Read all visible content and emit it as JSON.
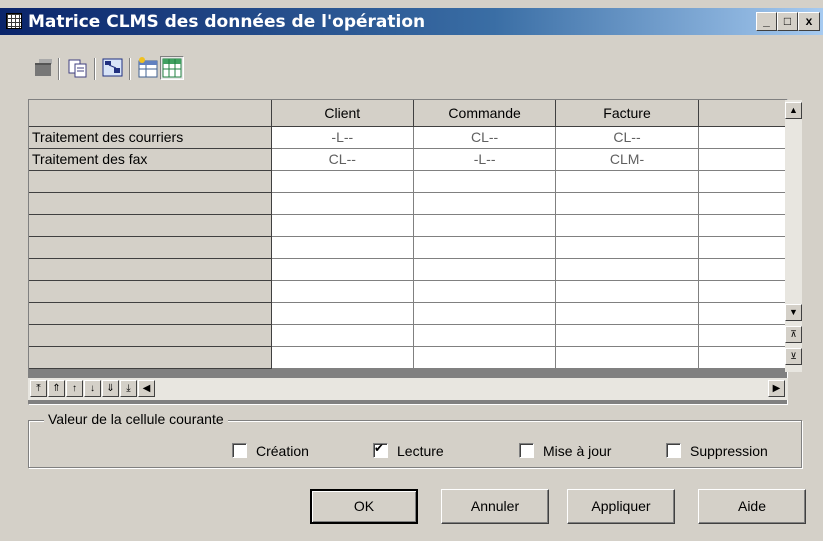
{
  "window": {
    "title": "Matrice CLMS des données de l'opération"
  },
  "title_buttons": {
    "minimize": "_",
    "maximize": "□",
    "close": "x"
  },
  "toolbar": {
    "tools": [
      {
        "icon": "properties-icon"
      },
      {
        "icon": "copy-icon"
      },
      {
        "icon": "find-in-diagram-icon"
      },
      {
        "icon": "add-row-icon"
      },
      {
        "icon": "matrix-view-icon",
        "pressed": true
      }
    ]
  },
  "matrix": {
    "columns": [
      "Client",
      "Commande",
      "Facture",
      ""
    ],
    "rows": [
      {
        "label": "Traitement des courriers",
        "values": [
          "-L--",
          "CL--",
          "CL--",
          ""
        ]
      },
      {
        "label": "Traitement des fax",
        "values": [
          "CL--",
          "-L--",
          "CLM-",
          ""
        ]
      },
      {
        "label": "",
        "values": [
          "",
          "",
          "",
          ""
        ]
      },
      {
        "label": "",
        "values": [
          "",
          "",
          "",
          ""
        ]
      },
      {
        "label": "",
        "values": [
          "",
          "",
          "",
          ""
        ]
      },
      {
        "label": "",
        "values": [
          "",
          "",
          "",
          ""
        ]
      },
      {
        "label": "",
        "values": [
          "",
          "",
          "",
          ""
        ]
      },
      {
        "label": "",
        "values": [
          "",
          "",
          "",
          ""
        ]
      },
      {
        "label": "",
        "values": [
          "",
          "",
          "",
          ""
        ]
      },
      {
        "label": "",
        "values": [
          "",
          "",
          "",
          ""
        ]
      },
      {
        "label": "",
        "values": [
          "",
          "",
          "",
          ""
        ]
      }
    ]
  },
  "current_cell": {
    "group_label": "Valeur de la cellule courante",
    "creation": {
      "label": "Création",
      "checked": false
    },
    "lecture": {
      "label": "Lecture",
      "checked": true
    },
    "mise_a_jour": {
      "label": "Mise à jour",
      "checked": false
    },
    "suppression": {
      "label": "Suppression",
      "checked": false
    }
  },
  "buttons": {
    "ok": "OK",
    "annuler": "Annuler",
    "appliquer": "Appliquer",
    "aide": "Aide"
  }
}
